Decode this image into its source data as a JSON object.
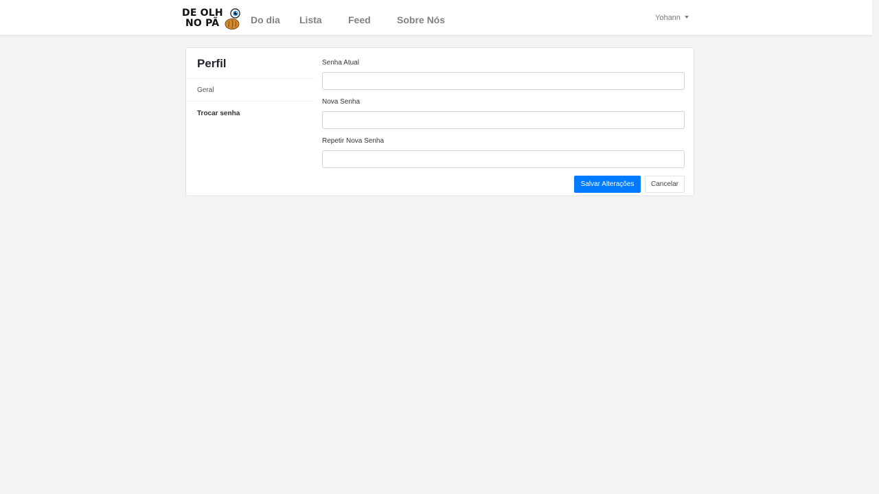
{
  "colors": {
    "background": "#f4f4f4",
    "navbar": "#ffffff",
    "accent": "#007bff",
    "nav_text": "#808080"
  },
  "brand": {
    "line1": "DE OLH",
    "line2": "NO PÃ",
    "eye_icon": "eye-icon",
    "bread_icon": "bread-icon"
  },
  "nav": {
    "links": [
      "Do dia",
      "Lista",
      "Feed",
      "Sobre Nós"
    ],
    "user": "Yohann",
    "user_icon": "chevron-down-icon"
  },
  "sidebar": {
    "title": "Perfil",
    "items": [
      {
        "label": "Geral",
        "active": false
      },
      {
        "label": "Trocar senha",
        "active": true
      }
    ]
  },
  "form": {
    "fields": [
      {
        "label": "Senha Atual",
        "value": ""
      },
      {
        "label": "Nova Senha",
        "value": ""
      },
      {
        "label": "Repetir Nova Senha",
        "value": ""
      }
    ],
    "save_label": "Salvar Alterações",
    "cancel_label": "Cancelar"
  }
}
